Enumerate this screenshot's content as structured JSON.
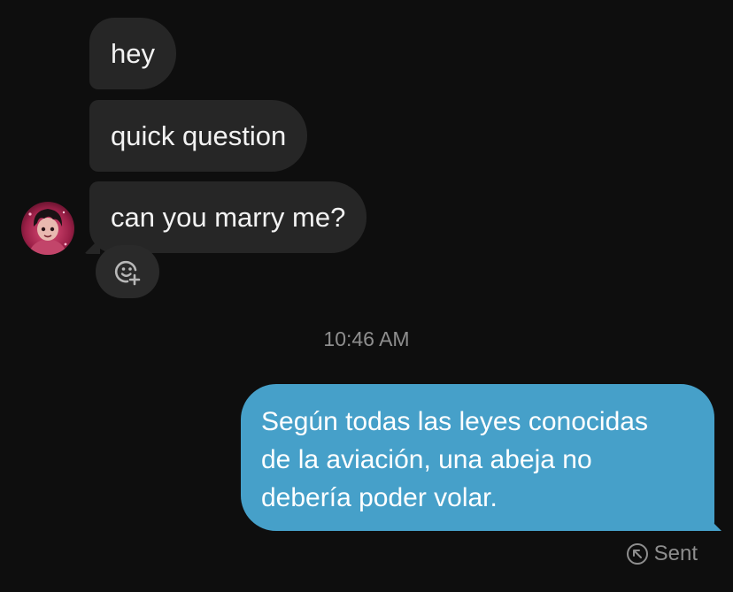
{
  "conversation": {
    "incoming_messages": [
      {
        "text": "hey"
      },
      {
        "text": "quick question"
      },
      {
        "text": "can you marry me?"
      }
    ],
    "timestamp": "10:46 AM",
    "outgoing_message": {
      "lines": [
        "Según todas las leyes conocidas",
        "de la aviación, una abeja no",
        "debería poder volar."
      ]
    },
    "status": "Sent"
  },
  "icons": {
    "reaction": "add-reaction-icon",
    "status": "sent-arrow-icon",
    "avatar": "user-avatar"
  },
  "colors": {
    "background": "#0e0e0e",
    "incoming_bubble": "#262626",
    "outgoing_bubble": "#46a0c9",
    "meta_text": "#8e8e8e"
  }
}
